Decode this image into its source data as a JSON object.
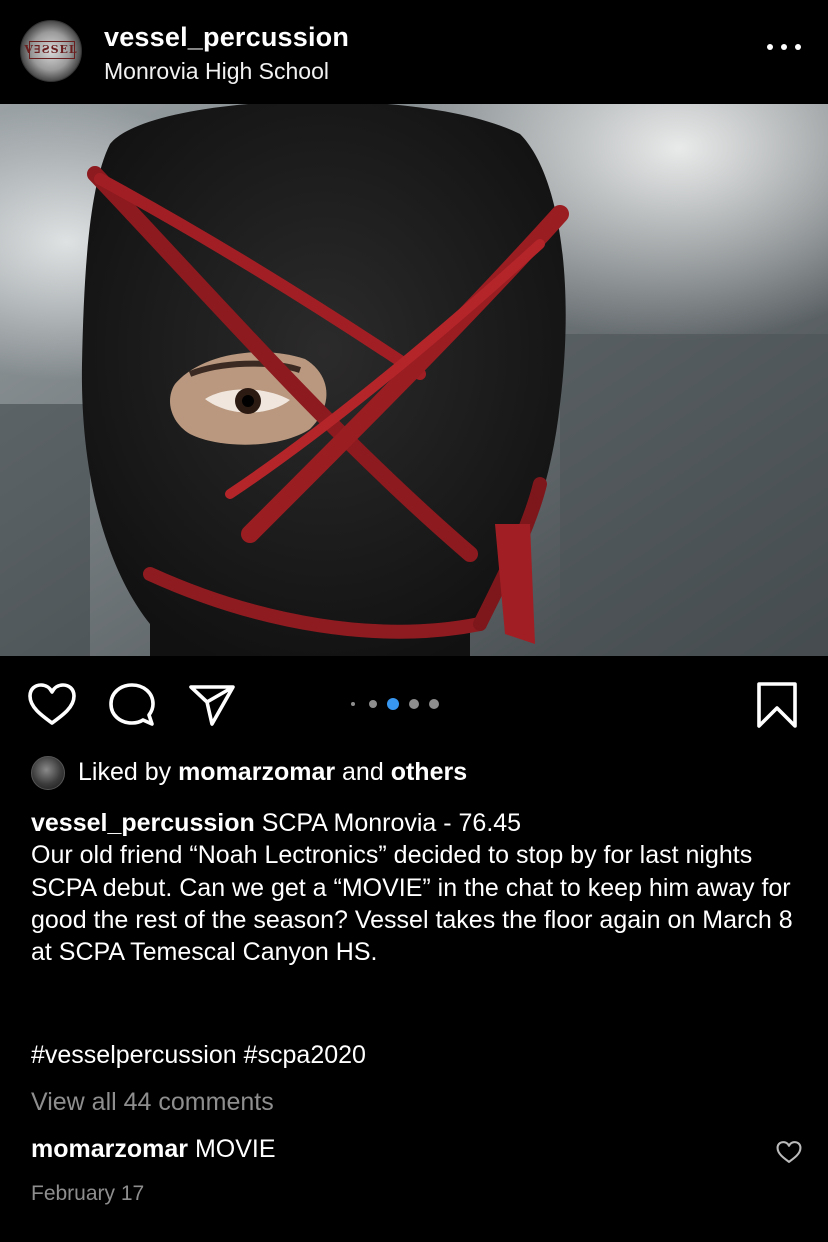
{
  "post": {
    "username": "vessel_percussion",
    "location": "Monrovia High School",
    "avatar_logo": "V∃ƧSEL",
    "icons": {
      "more": "more-options-icon",
      "like": "heart-icon",
      "comment": "comment-icon",
      "share": "send-icon",
      "save": "bookmark-icon"
    },
    "carousel": {
      "slide_count": 5,
      "active_index": 2,
      "active_color": "#3897f0"
    },
    "likes": {
      "prefix": "Liked by",
      "user": "momarzomar",
      "conjunction": "and",
      "others": "others"
    },
    "caption": {
      "author": "vessel_percussion",
      "text": "SCPA Monrovia - 76.45\nOur old friend “Noah Lectronics” decided to stop by for last nights SCPA debut. Can we get a “MOVIE” in the chat to keep him away for good the rest of the season? Vessel takes the floor again on March 8 at SCPA Temescal Canyon HS.",
      "hashtags": "#vesselpercussion #scpa2020"
    },
    "view_comments": "View all 44 comments",
    "top_comment": {
      "user": "momarzomar",
      "text": "MOVIE"
    },
    "date": "February 17"
  }
}
